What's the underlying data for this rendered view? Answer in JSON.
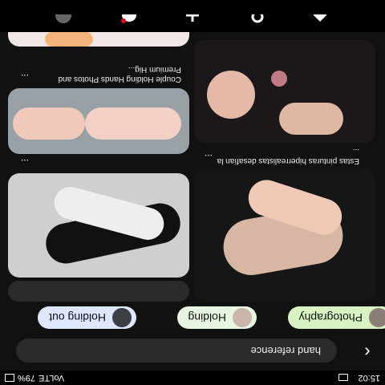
{
  "status": {
    "time": "15:02",
    "battery": "79%",
    "signal": "VoLTE"
  },
  "search": {
    "query": "hand reference"
  },
  "chips": [
    {
      "label": "Photography"
    },
    {
      "label": "Holding"
    },
    {
      "label": "Holding out"
    }
  ],
  "pins": [
    {
      "caption": "Estas pinturas hiperrealistas desafían la ...",
      "more": "..."
    },
    {
      "caption": "Couple Holding Hands Photos and Premium Hig...",
      "more": "..."
    },
    {
      "caption": "",
      "more": "..."
    },
    {
      "caption": "",
      "more": "..."
    }
  ],
  "nav": {
    "items": [
      "home-icon",
      "search-icon",
      "plus-icon",
      "messages-icon",
      "profile-icon"
    ]
  }
}
